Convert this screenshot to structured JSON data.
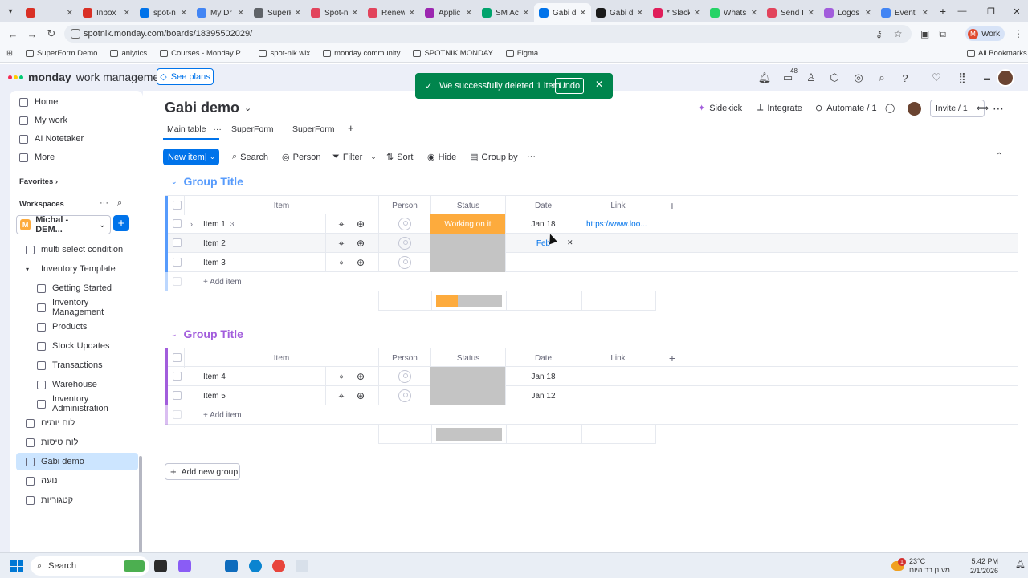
{
  "browser": {
    "tabs": [
      {
        "title": "",
        "color": "#d93025"
      },
      {
        "title": "Inbox",
        "color": "#d93025"
      },
      {
        "title": "spot-n",
        "color": "#0073ea"
      },
      {
        "title": "My Dr",
        "color": "#4285f4"
      },
      {
        "title": "SuperF",
        "color": "#5f6368"
      },
      {
        "title": "Spot-n",
        "color": "#e2445c"
      },
      {
        "title": "Renew",
        "color": "#e2445c"
      },
      {
        "title": "Applic",
        "color": "#9c27b0"
      },
      {
        "title": "SM Ac",
        "color": "#00a36c"
      },
      {
        "title": "Gabi d",
        "color": "#0073ea"
      },
      {
        "title": "Gabi d",
        "color": "#1a1a1a"
      },
      {
        "title": "* Slack",
        "color": "#e01e5a"
      },
      {
        "title": "Whats",
        "color": "#25d366"
      },
      {
        "title": "Send I",
        "color": "#e2445c"
      },
      {
        "title": "Logos",
        "color": "#a25ddc"
      },
      {
        "title": "Event",
        "color": "#4285f4"
      }
    ],
    "active_tab_index": 9,
    "url": "spotnik.monday.com/boards/18395502029/",
    "profile_label": "Work",
    "profile_initial": "M",
    "bookmarks": [
      "SuperForm Demo",
      "anlytics",
      "Courses - Monday P...",
      "spot-nik wix",
      "monday community",
      "SPOTNIK MONDAY",
      "Figma"
    ],
    "all_bookmarks": "All Bookmarks"
  },
  "app": {
    "brand": "monday",
    "brand_sub": "work management",
    "see_plans": "See plans",
    "inbox_badge": "48"
  },
  "sidebar": {
    "top_items": [
      "Home",
      "My work",
      "AI Notetaker",
      "More"
    ],
    "favorites_label": "Favorites",
    "workspaces_label": "Workspaces",
    "workspace_name": "Michal - DEM...",
    "workspace_initial": "M",
    "items": [
      {
        "label": "multi select condition",
        "sub": false
      },
      {
        "label": "Inventory Template",
        "sub": false,
        "folder": true
      },
      {
        "label": "Getting Started",
        "sub": true
      },
      {
        "label": "Inventory Management",
        "sub": true
      },
      {
        "label": "Products",
        "sub": true
      },
      {
        "label": "Stock Updates",
        "sub": true
      },
      {
        "label": "Transactions",
        "sub": true
      },
      {
        "label": "Warehouse",
        "sub": true
      },
      {
        "label": "Inventory Administration",
        "sub": true
      },
      {
        "label": "לוח יומים",
        "sub": false
      },
      {
        "label": "לוח טיסות",
        "sub": false
      },
      {
        "label": "Gabi demo",
        "sub": false,
        "active": true
      },
      {
        "label": "נועה",
        "sub": false
      },
      {
        "label": "קטגוריות",
        "sub": false
      }
    ]
  },
  "board": {
    "title": "Gabi demo",
    "views": [
      "Main table",
      "SuperForm",
      "SuperForm"
    ],
    "actions": {
      "sidekick": "Sidekick",
      "integrate": "Integrate",
      "automate": "Automate / 1",
      "invite": "Invite / 1"
    },
    "toolbar": {
      "new_item": "New item",
      "search": "Search",
      "person": "Person",
      "filter": "Filter",
      "sort": "Sort",
      "hide": "Hide",
      "group_by": "Group by"
    },
    "columns": {
      "item": "Item",
      "person": "Person",
      "status": "Status",
      "date": "Date",
      "link": "Link"
    },
    "add_item": "+ Add item",
    "add_group": "Add new group",
    "groups": [
      {
        "title": "Group Title",
        "color": "#579bfc",
        "rows": [
          {
            "name": "Item 1",
            "subitems": "3",
            "status": "Working on it",
            "status_color": "#fdab3d",
            "date": "Jan 18",
            "link": "https://www.loo..."
          },
          {
            "name": "Item 2",
            "subitems": "",
            "status": "",
            "status_color": "#c4c4c4",
            "date": "Feb",
            "link": ""
          },
          {
            "name": "Item 3",
            "subitems": "",
            "status": "",
            "status_color": "#c4c4c4",
            "date": "",
            "link": ""
          }
        ],
        "summary": [
          {
            "color": "#fdab3d",
            "share": 0.33
          },
          {
            "color": "#c4c4c4",
            "share": 0.67
          }
        ]
      },
      {
        "title": "Group Title",
        "color": "#a25ddc",
        "rows": [
          {
            "name": "Item 4",
            "subitems": "",
            "status": "",
            "status_color": "#c4c4c4",
            "date": "Jan 18",
            "link": ""
          },
          {
            "name": "Item 5",
            "subitems": "",
            "status": "",
            "status_color": "#c4c4c4",
            "date": "Jan 12",
            "link": ""
          }
        ],
        "summary": [
          {
            "color": "#c4c4c4",
            "share": 1.0
          }
        ]
      }
    ]
  },
  "toast": {
    "message": "We successfully deleted 1 item",
    "undo": "Undo",
    "color": "#00854d"
  },
  "taskbar": {
    "search": "Search",
    "weather_temp": "23°C",
    "weather_desc": "מעונן רב היום",
    "weather_badge": "1",
    "time": "5:42 PM",
    "date": "2/1/2026"
  }
}
